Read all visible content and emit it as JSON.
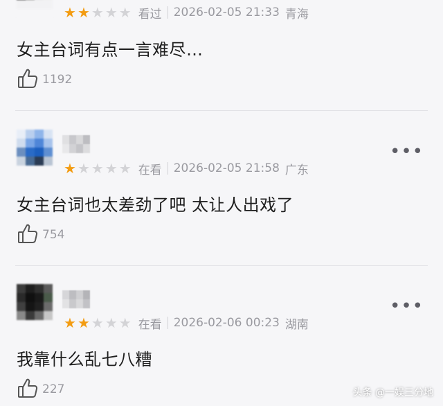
{
  "comments": [
    {
      "rating": 2,
      "status": "看过",
      "datetime": "2026-02-05 21:33",
      "location": "青海",
      "text": "女主台词有点一言难尽…",
      "likes": "1192",
      "avatar_pixels": [
        "#3c3c3c",
        "#6a6a6a",
        "#efefef",
        "#f2f2f2",
        "#2a2a2a",
        "#8a8a8a",
        "#e8e8e8",
        "#f0f0f0",
        "#f2f2f4",
        "#f2f2f4",
        "#f2f2f4",
        "#f2f2f4",
        "#f6f6f8",
        "#f6f6f8",
        "#f6f6f8",
        "#f6f6f8"
      ],
      "username_pixels": []
    },
    {
      "rating": 1,
      "status": "在看",
      "datetime": "2026-02-05 21:58",
      "location": "广东",
      "text": "女主台词也太差劲了吧 太让人出戏了",
      "likes": "754",
      "avatar_pixels": [
        "#e8eef7",
        "#b9cfee",
        "#8fb5ea",
        "#d8e3f3",
        "#cfdcee",
        "#7aa6e6",
        "#4f86d8",
        "#a7c3ec",
        "#6c8fbf",
        "#2a6bc7",
        "#1c5fbf",
        "#5f8fd2",
        "#c9d3df",
        "#4a6b93",
        "#2b3c55",
        "#b8c4d3"
      ],
      "username_pixels": [
        "#e0e0e2",
        "#c8c8cc",
        "#d8d8da",
        "#bdbdc1",
        "#e8e8ea",
        "#d2d2d5",
        "#c4c4c8",
        "#dcdcde"
      ]
    },
    {
      "rating": 2,
      "status": "在看",
      "datetime": "2026-02-06 00:23",
      "location": "湖南",
      "text": "我靠什么乱七八糟",
      "likes": "227",
      "avatar_pixels": [
        "#3b3b3b",
        "#1e1e1e",
        "#2f2f2f",
        "#5a5a5a",
        "#2a2a2a",
        "#101010",
        "#1a1a1a",
        "#4a5a4a",
        "#404040",
        "#151515",
        "#202020",
        "#6b6b6b",
        "#8a8a8a",
        "#3a3a3a",
        "#6a6a6a",
        "#c6c6c6"
      ],
      "username_pixels": [
        "#d6d6d9",
        "#bdbdc1",
        "#cfcfd2",
        "#b4b4b8",
        "#e2e2e4",
        "#c9c9cc",
        "#d9d9db",
        "#c2c2c6"
      ]
    }
  ],
  "more_glyph": "•••",
  "watermark": "头条 @一娱三分地",
  "colors": {
    "star_on": "#f39c12",
    "star_off": "#d3d3d6",
    "meta_text": "#9a9aa0"
  },
  "icons": {
    "like": "thumbs-up-icon",
    "more": "more-dots-icon",
    "star": "star-icon"
  }
}
